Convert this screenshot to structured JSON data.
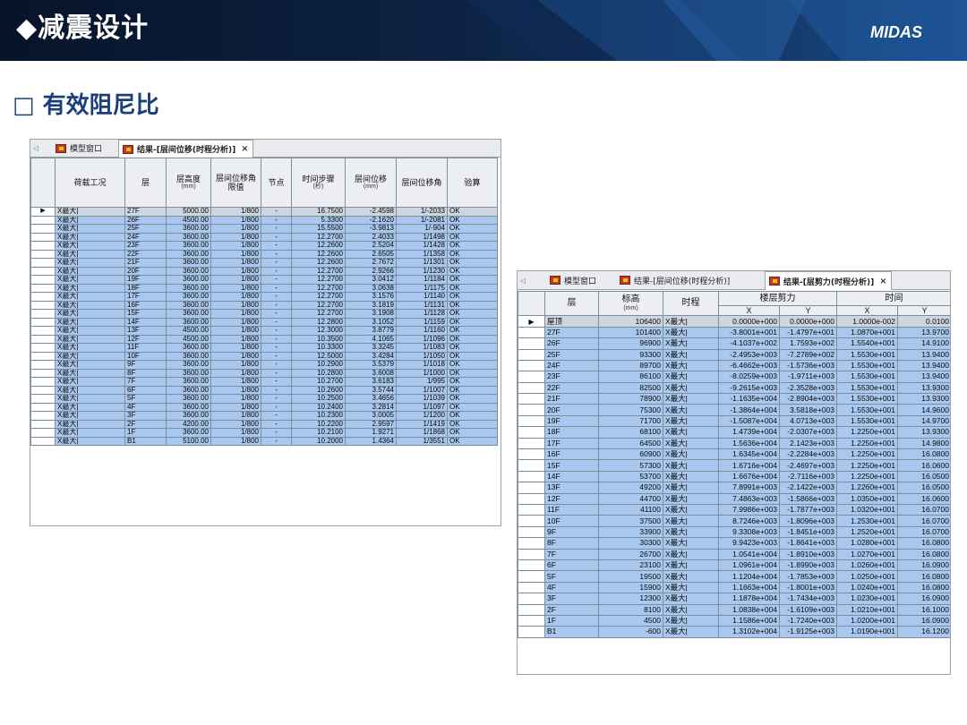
{
  "header": {
    "title": "◆减震设计",
    "logo": "MIDAS"
  },
  "section_title": "□ 有效阻尼比",
  "left_window": {
    "tabs": [
      {
        "label": "模型窗口"
      },
      {
        "label": "结果-[层间位移(时程分析)]"
      }
    ],
    "columns": [
      "荷载工况",
      "层",
      "层高度",
      "层间位移角限值",
      "节点",
      "时间步骤",
      "层间位移",
      "层间位移角",
      "验算"
    ],
    "column_units": [
      "",
      "",
      "(mm)",
      "",
      "",
      "(秒)",
      "(mm)",
      "",
      ""
    ],
    "rows": [
      [
        "X最大|",
        "27F",
        "5000.00",
        "1/800",
        "-",
        "16.7500",
        "-2.4598",
        "1/-2033",
        "OK"
      ],
      [
        "X最大|",
        "26F",
        "4500.00",
        "1/800",
        "-",
        "5.3300",
        "-2.1620",
        "1/-2081",
        "OK"
      ],
      [
        "X最大|",
        "25F",
        "3600.00",
        "1/800",
        "-",
        "15.5500",
        "-3.9813",
        "1/-904",
        "OK"
      ],
      [
        "X最大|",
        "24F",
        "3600.00",
        "1/800",
        "-",
        "12.2700",
        "2.4033",
        "1/1498",
        "OK"
      ],
      [
        "X最大|",
        "23F",
        "3600.00",
        "1/800",
        "-",
        "12.2600",
        "2.5204",
        "1/1428",
        "OK"
      ],
      [
        "X最大|",
        "22F",
        "3600.00",
        "1/800",
        "-",
        "12.2600",
        "2.6505",
        "1/1358",
        "OK"
      ],
      [
        "X最大|",
        "21F",
        "3600.00",
        "1/800",
        "-",
        "12.2600",
        "2.7672",
        "1/1301",
        "OK"
      ],
      [
        "X最大|",
        "20F",
        "3600.00",
        "1/800",
        "-",
        "12.2700",
        "2.9266",
        "1/1230",
        "OK"
      ],
      [
        "X最大|",
        "19F",
        "3600.00",
        "1/800",
        "-",
        "12.2700",
        "3.0412",
        "1/1184",
        "OK"
      ],
      [
        "X最大|",
        "18F",
        "3600.00",
        "1/800",
        "-",
        "12.2700",
        "3.0638",
        "1/1175",
        "OK"
      ],
      [
        "X最大|",
        "17F",
        "3600.00",
        "1/800",
        "-",
        "12.2700",
        "3.1576",
        "1/1140",
        "OK"
      ],
      [
        "X最大|",
        "16F",
        "3600.00",
        "1/800",
        "-",
        "12.2700",
        "3.1819",
        "1/1131",
        "OK"
      ],
      [
        "X最大|",
        "15F",
        "3600.00",
        "1/800",
        "-",
        "12.2700",
        "3.1908",
        "1/1128",
        "OK"
      ],
      [
        "X最大|",
        "14F",
        "3600.00",
        "1/800",
        "-",
        "12.2800",
        "3.1052",
        "1/1159",
        "OK"
      ],
      [
        "X最大|",
        "13F",
        "4500.00",
        "1/800",
        "-",
        "12.3000",
        "3.8779",
        "1/1160",
        "OK"
      ],
      [
        "X最大|",
        "12F",
        "4500.00",
        "1/800",
        "-",
        "10.3500",
        "4.1065",
        "1/1096",
        "OK"
      ],
      [
        "X最大|",
        "11F",
        "3600.00",
        "1/800",
        "-",
        "10.3300",
        "3.3245",
        "1/1083",
        "OK"
      ],
      [
        "X最大|",
        "10F",
        "3600.00",
        "1/800",
        "-",
        "12.5000",
        "3.4284",
        "1/1050",
        "OK"
      ],
      [
        "X最大|",
        "9F",
        "3600.00",
        "1/800",
        "-",
        "10.2900",
        "3.5379",
        "1/1018",
        "OK"
      ],
      [
        "X最大|",
        "8F",
        "3600.00",
        "1/800",
        "-",
        "10.2800",
        "3.6008",
        "1/1000",
        "OK"
      ],
      [
        "X最大|",
        "7F",
        "3600.00",
        "1/800",
        "-",
        "10.2700",
        "3.6183",
        "1/995",
        "OK"
      ],
      [
        "X最大|",
        "6F",
        "3600.00",
        "1/800",
        "-",
        "10.2600",
        "3.5744",
        "1/1007",
        "OK"
      ],
      [
        "X最大|",
        "5F",
        "3600.00",
        "1/800",
        "-",
        "10.2500",
        "3.4656",
        "1/1039",
        "OK"
      ],
      [
        "X最大|",
        "4F",
        "3600.00",
        "1/800",
        "-",
        "10.2400",
        "3.2814",
        "1/1097",
        "OK"
      ],
      [
        "X最大|",
        "3F",
        "3600.00",
        "1/800",
        "-",
        "10.2300",
        "3.0005",
        "1/1200",
        "OK"
      ],
      [
        "X最大|",
        "2F",
        "4200.00",
        "1/800",
        "-",
        "10.2200",
        "2.9597",
        "1/1419",
        "OK"
      ],
      [
        "X最大|",
        "1F",
        "3600.00",
        "1/800",
        "-",
        "10.2100",
        "1.9271",
        "1/1868",
        "OK"
      ],
      [
        "X最大|",
        "B1",
        "5100.00",
        "1/800",
        "-",
        "10.2000",
        "1.4364",
        "1/3551",
        "OK"
      ]
    ]
  },
  "right_window": {
    "tabs": [
      {
        "label": "模型窗口"
      },
      {
        "label": "结果-[层间位移(时程分析)]"
      },
      {
        "label": "结果-[层剪力(时程分析)]"
      }
    ],
    "columns": {
      "floor": "层",
      "elevation": "标高",
      "elevation_unit": "(mm)",
      "time_history": "时程",
      "shear_group": "楼层剪力",
      "time_group": "时间",
      "x": "X",
      "y": "Y"
    },
    "rows": [
      [
        "屋顶",
        "106400",
        "X最大|",
        "0.0000e+000",
        "0.0000e+000",
        "1.0000e-002",
        "0.0100"
      ],
      [
        "27F",
        "101400",
        "X最大|",
        "-3.8001e+001",
        "-1.4797e+001",
        "1.0870e+001",
        "13.9700"
      ],
      [
        "26F",
        "96900",
        "X最大|",
        "-4.1037e+002",
        "1.7593e+002",
        "1.5540e+001",
        "14.9100"
      ],
      [
        "25F",
        "93300",
        "X最大|",
        "-2.4953e+003",
        "-7.2789e+002",
        "1.5530e+001",
        "13.9400"
      ],
      [
        "24F",
        "89700",
        "X最大|",
        "-6.4662e+003",
        "-1.5736e+003",
        "1.5530e+001",
        "13.9400"
      ],
      [
        "23F",
        "86100",
        "X最大|",
        "-8.0259e+003",
        "-1.9711e+003",
        "1.5530e+001",
        "13.9400"
      ],
      [
        "22F",
        "82500",
        "X最大|",
        "-9.2615e+003",
        "-2.3528e+003",
        "1.5530e+001",
        "13.9300"
      ],
      [
        "21F",
        "78900",
        "X最大|",
        "-1.1635e+004",
        "-2.8904e+003",
        "1.5530e+001",
        "13.9300"
      ],
      [
        "20F",
        "75300",
        "X最大|",
        "-1.3864e+004",
        "3.5818e+003",
        "1.5530e+001",
        "14.9600"
      ],
      [
        "19F",
        "71700",
        "X最大|",
        "-1.5087e+004",
        "4.0713e+003",
        "1.5530e+001",
        "14.9700"
      ],
      [
        "18F",
        "68100",
        "X最大|",
        "1.4739e+004",
        "-2.0307e+003",
        "1.2250e+001",
        "13.9300"
      ],
      [
        "17F",
        "64500",
        "X最大|",
        "1.5636e+004",
        "2.1423e+003",
        "1.2250e+001",
        "14.9800"
      ],
      [
        "16F",
        "60900",
        "X最大|",
        "1.6345e+004",
        "-2.2284e+003",
        "1.2250e+001",
        "16.0800"
      ],
      [
        "15F",
        "57300",
        "X最大|",
        "1.6716e+004",
        "-2.4697e+003",
        "1.2250e+001",
        "16.0600"
      ],
      [
        "14F",
        "53700",
        "X最大|",
        "1.6676e+004",
        "-2.7116e+003",
        "1.2250e+001",
        "16.0500"
      ],
      [
        "13F",
        "49200",
        "X最大|",
        "7.8991e+003",
        "-2.1422e+003",
        "1.2260e+001",
        "16.0500"
      ],
      [
        "12F",
        "44700",
        "X最大|",
        "7.4863e+003",
        "-1.5866e+003",
        "1.0350e+001",
        "16.0600"
      ],
      [
        "11F",
        "41100",
        "X最大|",
        "7.9986e+003",
        "-1.7877e+003",
        "1.0320e+001",
        "16.0700"
      ],
      [
        "10F",
        "37500",
        "X最大|",
        "8.7246e+003",
        "-1.8096e+003",
        "1.2530e+001",
        "16.0700"
      ],
      [
        "9F",
        "33900",
        "X最大|",
        "9.3308e+003",
        "-1.8451e+003",
        "1.2520e+001",
        "16.0700"
      ],
      [
        "8F",
        "30300",
        "X最大|",
        "9.9423e+003",
        "-1.8641e+003",
        "1.0280e+001",
        "16.0800"
      ],
      [
        "7F",
        "26700",
        "X最大|",
        "1.0541e+004",
        "-1.8910e+003",
        "1.0270e+001",
        "16.0800"
      ],
      [
        "6F",
        "23100",
        "X最大|",
        "1.0961e+004",
        "-1.8990e+003",
        "1.0260e+001",
        "16.0900"
      ],
      [
        "5F",
        "19500",
        "X最大|",
        "1.1204e+004",
        "-1.7853e+003",
        "1.0250e+001",
        "16.0800"
      ],
      [
        "4F",
        "15900",
        "X最大|",
        "1.1663e+004",
        "-1.8001e+003",
        "1.0240e+001",
        "16.0800"
      ],
      [
        "3F",
        "12300",
        "X最大|",
        "1.1878e+004",
        "-1.7434e+003",
        "1.0230e+001",
        "16.0900"
      ],
      [
        "2F",
        "8100",
        "X最大|",
        "1.0838e+004",
        "-1.6109e+003",
        "1.0210e+001",
        "16.1000"
      ],
      [
        "1F",
        "4500",
        "X最大|",
        "1.1586e+004",
        "-1.7240e+003",
        "1.0200e+001",
        "16.0900"
      ],
      [
        "B1",
        "-600",
        "X最大|",
        "1.3102e+004",
        "-1.9125e+003",
        "1.0190e+001",
        "16.1200"
      ]
    ]
  }
}
